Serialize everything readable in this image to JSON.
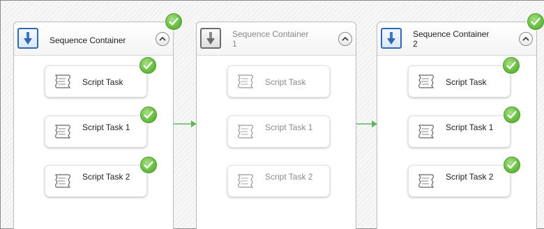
{
  "canvas": {
    "background": "#f7f7f7"
  },
  "containers": [
    {
      "title": "Sequence Container",
      "state": "success",
      "tasks": [
        {
          "label": "Script Task",
          "state": "success"
        },
        {
          "label": "Script Task 1",
          "state": "success"
        },
        {
          "label": "Script Task 2",
          "state": "success"
        }
      ]
    },
    {
      "title": "Sequence Container 1",
      "state": "disabled",
      "tasks": [
        {
          "label": "Script Task",
          "state": "disabled"
        },
        {
          "label": "Script Task 1",
          "state": "disabled"
        },
        {
          "label": "Script Task 2",
          "state": "disabled"
        }
      ]
    },
    {
      "title": "Sequence Container 2",
      "state": "success",
      "tasks": [
        {
          "label": "Script Task",
          "state": "success"
        },
        {
          "label": "Script Task 1",
          "state": "success"
        },
        {
          "label": "Script Task 2",
          "state": "success"
        }
      ]
    }
  ],
  "colors": {
    "success_green": "#69c043",
    "connector_green": "#5cb85c",
    "container_icon_blue": "#2f67b4"
  },
  "icons": {
    "container": "sequence-container-icon",
    "task": "script-task-icon",
    "collapse": "chevron-up-icon",
    "status": "checkmark-icon"
  }
}
